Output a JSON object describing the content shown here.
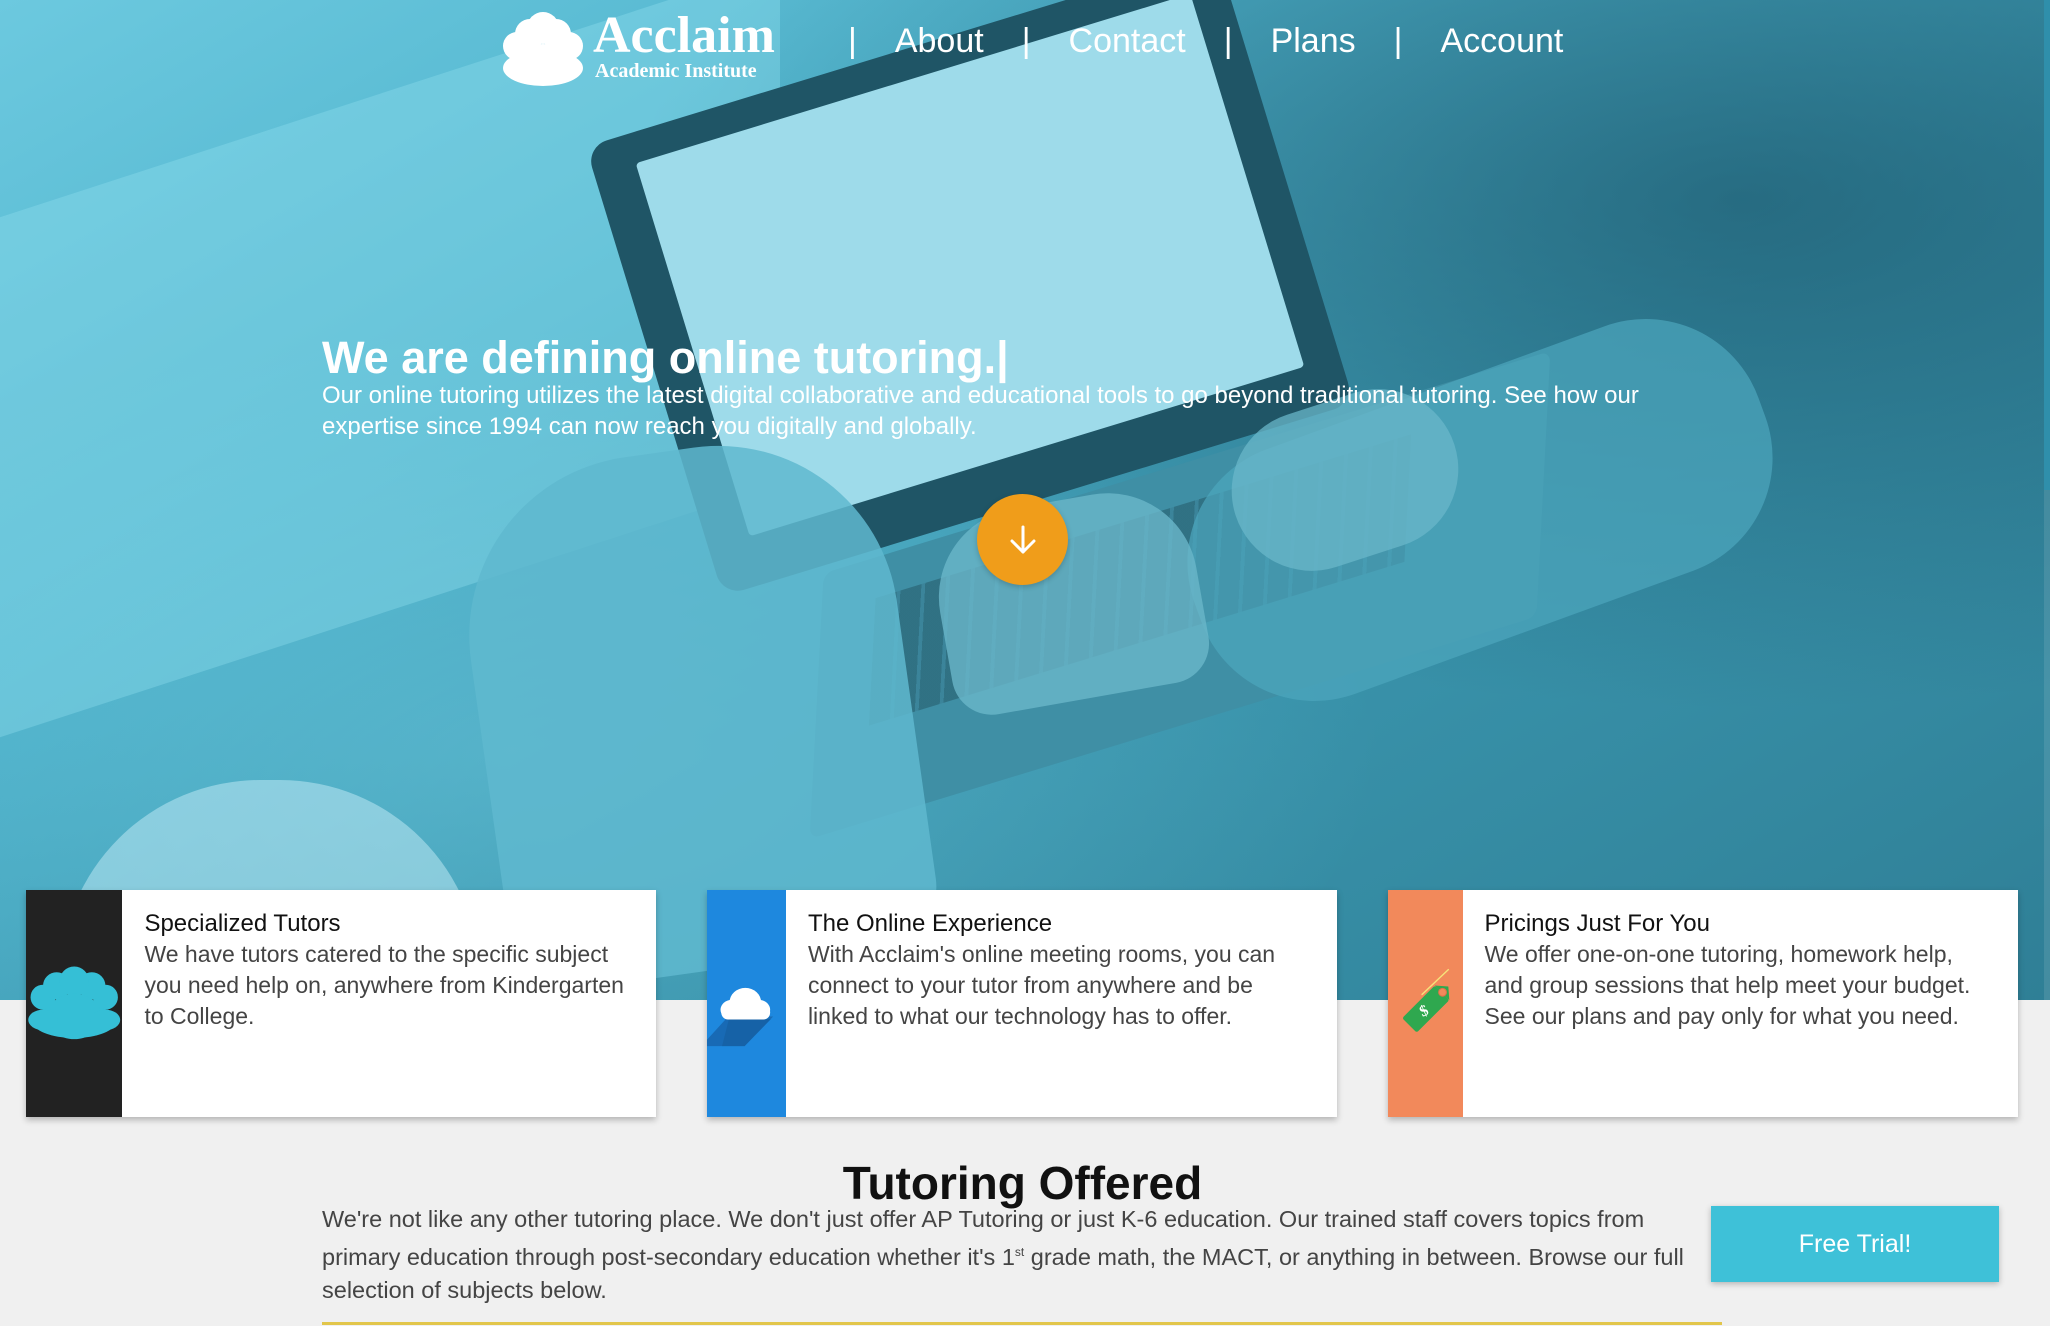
{
  "brand": {
    "title": "Acclaim",
    "subtitle": "Academic Institute"
  },
  "nav": {
    "separator": "|",
    "items": [
      {
        "label": "About"
      },
      {
        "label": "Contact"
      },
      {
        "label": "Plans"
      },
      {
        "label": "Account"
      }
    ]
  },
  "hero": {
    "title": "We are defining online tutoring.|",
    "description": "Our online tutoring utilizes the latest digital collaborative and educational tools to go beyond traditional tutoring. See how our expertise since 1994 can now reach you digitally and globally.",
    "scroll_button_icon": "arrow-down-icon"
  },
  "features": [
    {
      "icon": "people-group-icon",
      "icon_bg": "#222222",
      "title": "Specialized Tutors",
      "text": "We have tutors catered to the specific subject you need help on, anywhere from Kindergarten to College."
    },
    {
      "icon": "cloud-icon",
      "icon_bg": "#1e88de",
      "title": "The Online Experience",
      "text": "With Acclaim's online meeting rooms, you can connect to your tutor from anywhere and be linked to what our technology has to offer."
    },
    {
      "icon": "price-tag-icon",
      "icon_bg": "#f2895b",
      "title": "Pricings Just For You",
      "text": "We offer one-on-one tutoring, homework help, and group sessions that help meet your budget. See our plans and pay only for what you need."
    }
  ],
  "tutoring": {
    "title": "Tutoring Offered",
    "text_before_sup": "We're not like any other tutoring place. We don't just offer AP Tutoring or just K-6 education. Our trained staff covers topics from primary education through post-secondary education whether it's 1",
    "sup": "st",
    "text_after_sup": " grade math, the MACT, or anything in between. Browse our full selection of subjects below.",
    "cta_label": "Free Trial!"
  },
  "colors": {
    "hero_overlay": "#4fb3cc",
    "accent_orange": "#f09d1a",
    "cta": "#3ec1d8",
    "divider": "#e2c64b"
  }
}
